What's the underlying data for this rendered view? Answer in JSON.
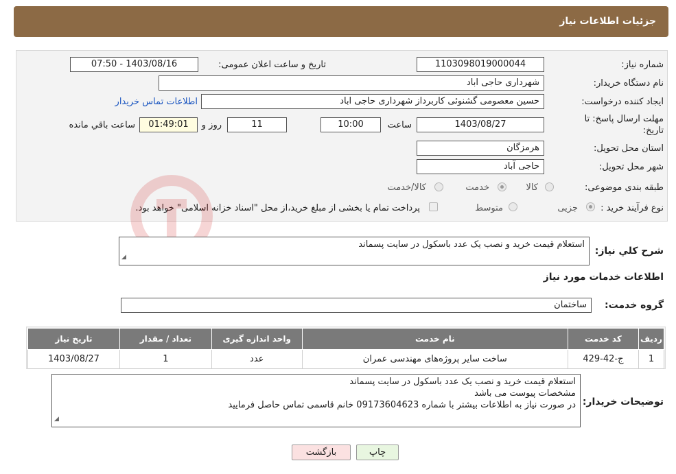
{
  "header": {
    "title": "جزئیات اطلاعات نیاز"
  },
  "form": {
    "need_number_label": "شماره نیاز:",
    "need_number": "1103098019000044",
    "announce_label": "تاریخ و ساعت اعلان عمومی:",
    "announce_value": "1403/08/16 - 07:50",
    "buyer_label": "نام دستگاه خریدار:",
    "buyer_value": "شهرداری حاجی اباد",
    "creator_label": "ایجاد کننده درخواست:",
    "creator_value": "حسین معصومی گشنوئی کاربرداز شهرداری حاجی اباد",
    "contact_link": "اطلاعات تماس خریدار",
    "deadline_label": "مهلت ارسال پاسخ: تا تاریخ:",
    "deadline_date": "1403/08/27",
    "time_label": "ساعت",
    "deadline_time": "10:00",
    "days_value": "11",
    "days_label": "روز و",
    "remaining_time": "01:49:01",
    "remaining_label": "ساعت باقي مانده",
    "province_label": "استان محل تحویل:",
    "province_value": "هرمزگان",
    "city_label": "شهر محل تحویل:",
    "city_value": "حاجی آباد",
    "category_label": "طبقه بندی موضوعی:",
    "category_options": [
      "کالا",
      "خدمت",
      "کالا/خدمت"
    ],
    "purchase_label": "نوع فرآیند خرید :",
    "purchase_options": [
      "جزیی",
      "متوسط"
    ],
    "payment_note": "پرداخت تمام یا بخشی از مبلغ خرید،از محل \"اسناد خزانه اسلامی\" خواهد بود."
  },
  "summary": {
    "label": "شرح کلي نياز:",
    "value": "استعلام قیمت خرید و نصب یک عدد باسکول در سایت پسماند"
  },
  "services": {
    "section_title": "اطلاعات خدمات مورد نياز",
    "group_label": "گروه خدمت:",
    "group_value": "ساختمان",
    "columns": [
      "رديف",
      "كد خدمت",
      "نام خدمت",
      "واحد اندازه گيری",
      "تعداد / مقدار",
      "تاريخ نياز"
    ],
    "rows": [
      [
        "1",
        "ج-42-429",
        "ساخت سایر پروژه‌های مهندسی عمران",
        "عدد",
        "1",
        "1403/08/27"
      ]
    ]
  },
  "buyer_notes": {
    "label": "توضيحات خريدار:",
    "lines": [
      "استعلام قیمت خرید و نصب یک عدد باسکول در سایت پسماند",
      "مشخصات پیوست می باشد",
      "در صورت نیاز به اطلاعات بیشتر با شماره 09173604623 خانم قاسمی تماس حاصل فرمایید"
    ]
  },
  "buttons": {
    "print": "چاپ",
    "back": "بازگشت"
  }
}
